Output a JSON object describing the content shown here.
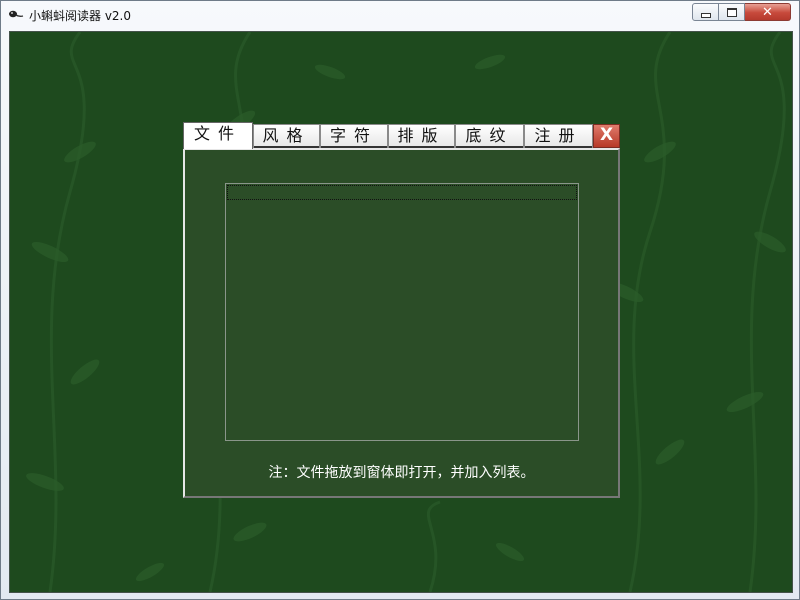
{
  "window": {
    "title": "小蝌蚪阅读器 v2.0",
    "icon": "tadpole-icon",
    "controls": [
      "minimize-icon",
      "maximize-icon",
      "close-icon"
    ]
  },
  "dialog": {
    "tabs": [
      {
        "label": "文件",
        "active": true
      },
      {
        "label": "风格",
        "active": false
      },
      {
        "label": "字符",
        "active": false
      },
      {
        "label": "排版",
        "active": false
      },
      {
        "label": "底纹",
        "active": false
      },
      {
        "label": "注册",
        "active": false
      }
    ],
    "close_label": "X",
    "file_list": [],
    "note": "注：文件拖放到窗体即打开，并加入列表。"
  },
  "colors": {
    "background": "#1e4a1e",
    "panel": "#2b4d27",
    "close_red": "#c7493b"
  }
}
